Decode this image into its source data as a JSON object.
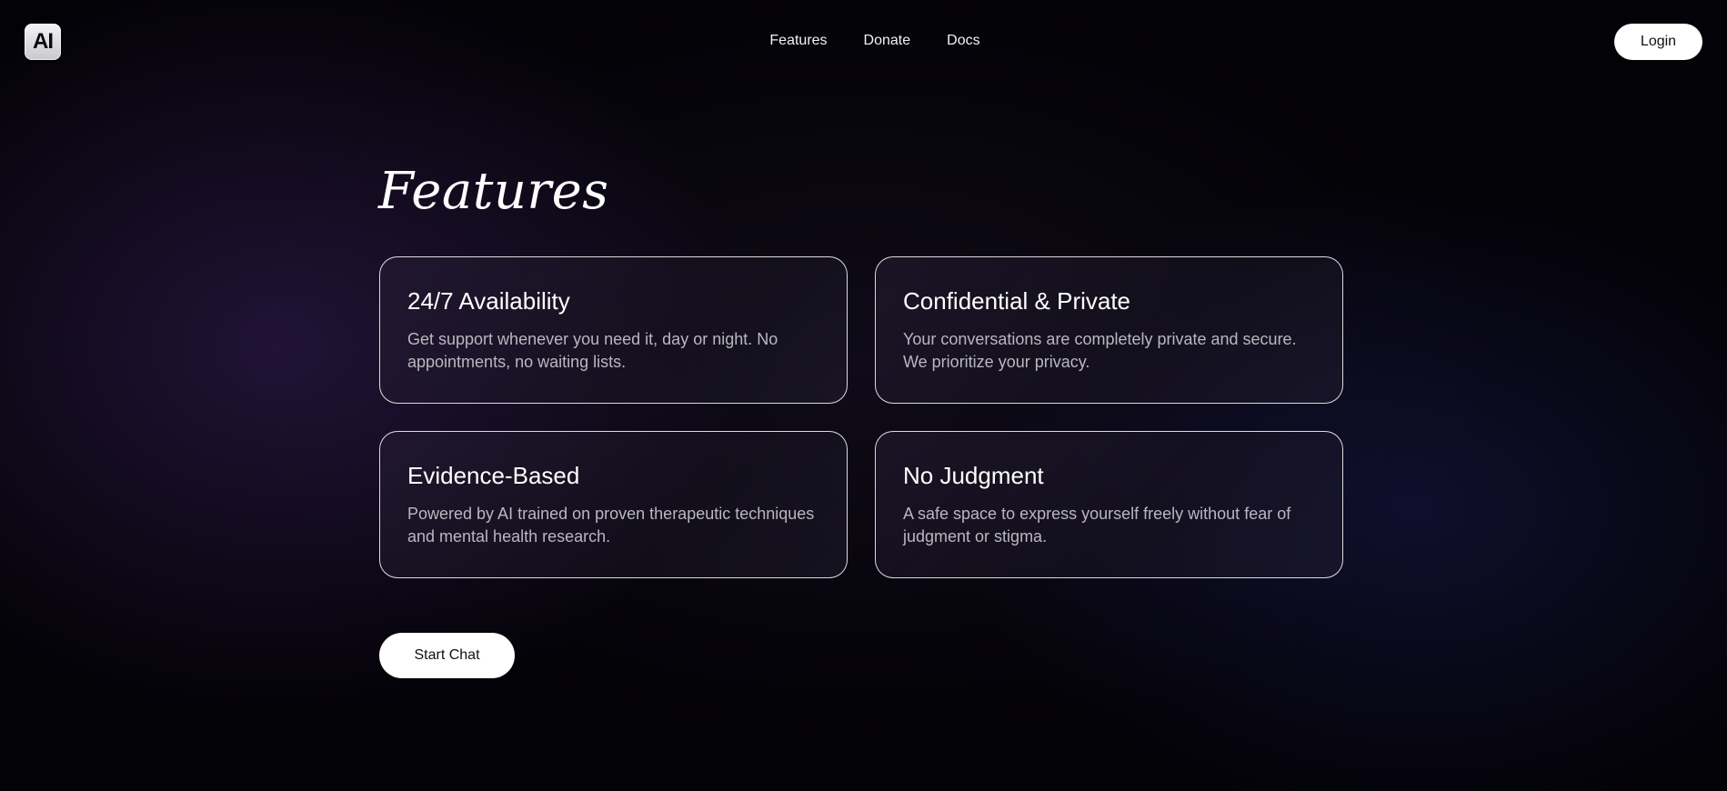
{
  "header": {
    "logo_text": "AI",
    "nav": [
      {
        "label": "Features"
      },
      {
        "label": "Donate"
      },
      {
        "label": "Docs"
      }
    ],
    "login_label": "Login"
  },
  "main": {
    "title": "Features",
    "cards": [
      {
        "title": "24/7 Availability",
        "description": "Get support whenever you need it, day or night. No appointments, no waiting lists."
      },
      {
        "title": "Confidential & Private",
        "description": "Your conversations are completely private and secure. We prioritize your privacy."
      },
      {
        "title": "Evidence-Based",
        "description": "Powered by AI trained on proven therapeutic techniques and mental health research."
      },
      {
        "title": "No Judgment",
        "description": "A safe space to express yourself freely without fear of judgment or stigma."
      }
    ],
    "cta_label": "Start Chat"
  },
  "colors": {
    "background": "#030206",
    "accent_glow_left": "#3a205c",
    "accent_glow_right": "#1e1e5a",
    "button_bg": "#ffffff",
    "card_border": "#ffffff",
    "description_text": "#b9b7c0"
  }
}
